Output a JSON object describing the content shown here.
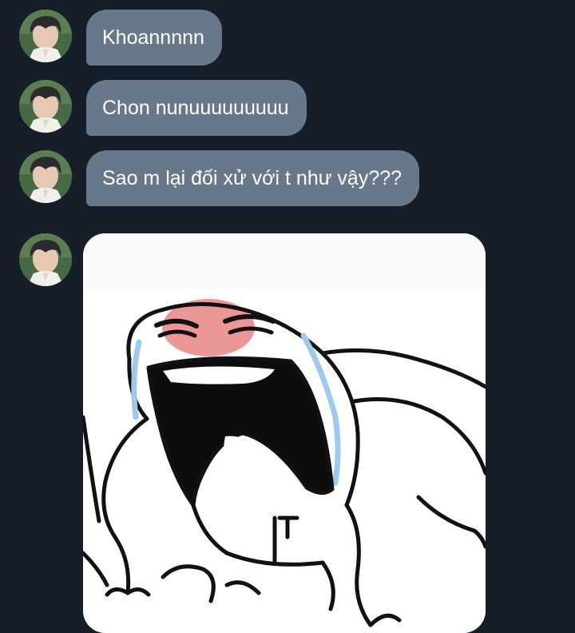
{
  "messages": [
    {
      "type": "text",
      "text": "Khoannnnn"
    },
    {
      "type": "text",
      "text": "Chon nunuuuuuuuuu"
    },
    {
      "type": "text",
      "text": "Sao m lại đối xử với t như vậy???"
    },
    {
      "type": "sticker",
      "subject": "crying screaming cartoon creature"
    }
  ],
  "avatar": {
    "icon": "user-avatar-photo-icon"
  },
  "colors": {
    "background": "#151e29",
    "bubble": "#67788a",
    "bubble_text": "#ffffff",
    "sticker_background": "#ffffff",
    "tears": "#9ec9f0",
    "blush": "#e88585"
  }
}
